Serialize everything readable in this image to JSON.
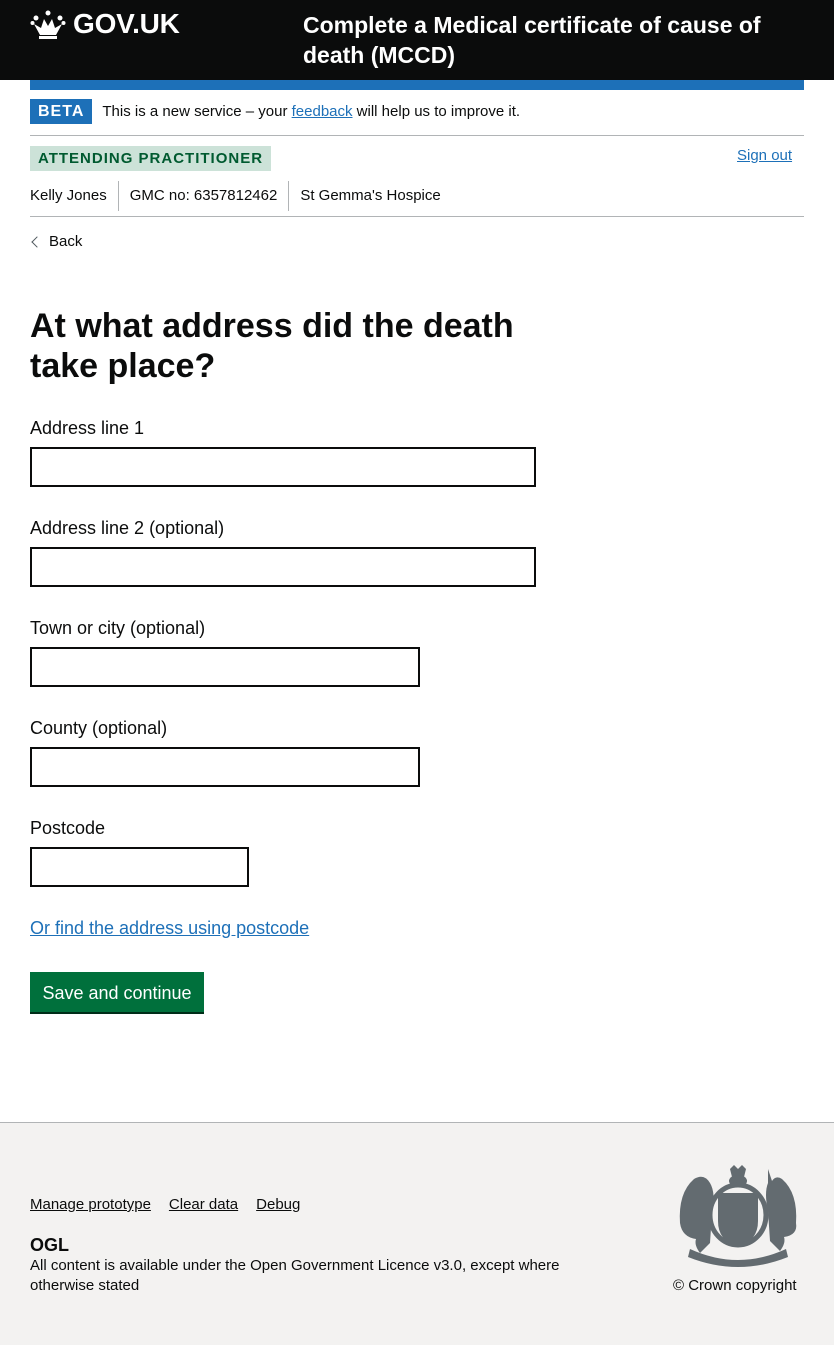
{
  "header": {
    "logo_text": "GOV.UK",
    "service_name": "Complete a Medical certificate of cause of death (MCCD)"
  },
  "beta": {
    "tag": "BETA",
    "text_before": "This is a new service – your ",
    "link": "feedback",
    "text_after": " will help us to improve it."
  },
  "role": {
    "tag": "ATTENDING PRACTITIONER",
    "sign_out": "Sign out"
  },
  "user": {
    "name": "Kelly Jones",
    "gmc": "GMC no: 6357812462",
    "organisation": "St Gemma's Hospice"
  },
  "back_label": "Back",
  "heading": "At what address did the death take place?",
  "form": {
    "address_line_1": {
      "label": "Address line 1",
      "value": ""
    },
    "address_line_2": {
      "label": "Address line 2 (optional)",
      "value": ""
    },
    "town": {
      "label": "Town or city (optional)",
      "value": ""
    },
    "county": {
      "label": "County (optional)",
      "value": ""
    },
    "postcode": {
      "label": "Postcode",
      "value": ""
    },
    "find_by_postcode_link": "Or find the address using postcode",
    "submit_label": "Save and continue"
  },
  "footer": {
    "links": [
      "Manage prototype",
      "Clear data",
      "Debug"
    ],
    "licence_before": "All content is available under the ",
    "licence_link": "Open Government Licence v3.0",
    "licence_after": ", except where otherwise stated",
    "copyright": "© Crown copyright",
    "ogl_logo": "OGL"
  },
  "colors": {
    "header_bg": "#0b0c0c",
    "brand_blue": "#1d70b8",
    "button_green": "#00703c",
    "role_tag_bg": "#cce2d8",
    "footer_bg": "#f3f2f1"
  }
}
